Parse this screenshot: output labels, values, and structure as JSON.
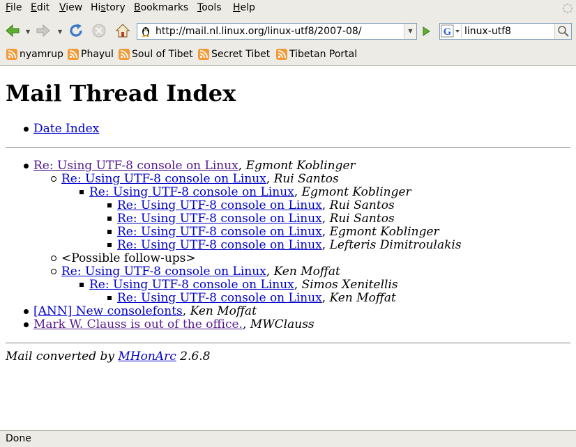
{
  "menu": [
    "File",
    "Edit",
    "View",
    "History",
    "Bookmarks",
    "Tools",
    "Help"
  ],
  "menu_mnemonic": [
    "F",
    "E",
    "V",
    "s",
    "B",
    "T",
    "H"
  ],
  "address": {
    "url": "http://mail.nl.linux.org/linux-utf8/2007-08/"
  },
  "search": {
    "value": "linux-utf8",
    "engine": "G"
  },
  "bookmarks": [
    "nyamrup",
    "Phayul",
    "Soul of Tibet",
    "Secret Tibet",
    "Tibetan Portal"
  ],
  "page": {
    "title": "Mail Thread Index",
    "top_link": "Date Index",
    "threads": [
      {
        "subject": "Re: Using UTF-8 console on Linux",
        "author": "Egmont Koblinger",
        "level": 0,
        "visited": true
      },
      {
        "subject": "Re: Using UTF-8 console on Linux",
        "author": "Rui Santos",
        "level": 1,
        "visited": false
      },
      {
        "subject": "Re: Using UTF-8 console on Linux",
        "author": "Egmont Koblinger",
        "level": 2,
        "visited": false
      },
      {
        "subject": "Re: Using UTF-8 console on Linux",
        "author": "Rui Santos",
        "level": 3,
        "visited": false
      },
      {
        "subject": "Re: Using UTF-8 console on Linux",
        "author": "Rui Santos",
        "level": 3,
        "visited": false
      },
      {
        "subject": "Re: Using UTF-8 console on Linux",
        "author": "Egmont Koblinger",
        "level": 3,
        "visited": false
      },
      {
        "subject": "Re: Using UTF-8 console on Linux",
        "author": "Lefteris Dimitroulakis",
        "level": 3,
        "visited": false
      },
      {
        "subject": "",
        "author": "",
        "plain": "<Possible follow-ups>",
        "level": 1,
        "visited": false
      },
      {
        "subject": "Re: Using UTF-8 console on Linux",
        "author": "Ken Moffat",
        "level": 1,
        "visited": false
      },
      {
        "subject": "Re: Using UTF-8 console on Linux",
        "author": "Simos Xenitellis",
        "level": 2,
        "visited": false
      },
      {
        "subject": "Re: Using UTF-8 console on Linux",
        "author": "Ken Moffat",
        "level": 3,
        "visited": false
      },
      {
        "subject": "[ANN] New consolefonts",
        "author": "Ken Moffat",
        "level": 0,
        "visited": false
      },
      {
        "subject": "Mark W. Clauss is out of the office.",
        "author": "MWClauss",
        "level": 0,
        "visited": true
      }
    ],
    "footer": {
      "prefix": "Mail converted by ",
      "link": "MHonArc",
      "suffix": " 2.6.8"
    }
  },
  "status": "Done",
  "colors": {
    "link": "#0000cc",
    "visited": "#551a8b",
    "chrome": "#ecebe6"
  }
}
